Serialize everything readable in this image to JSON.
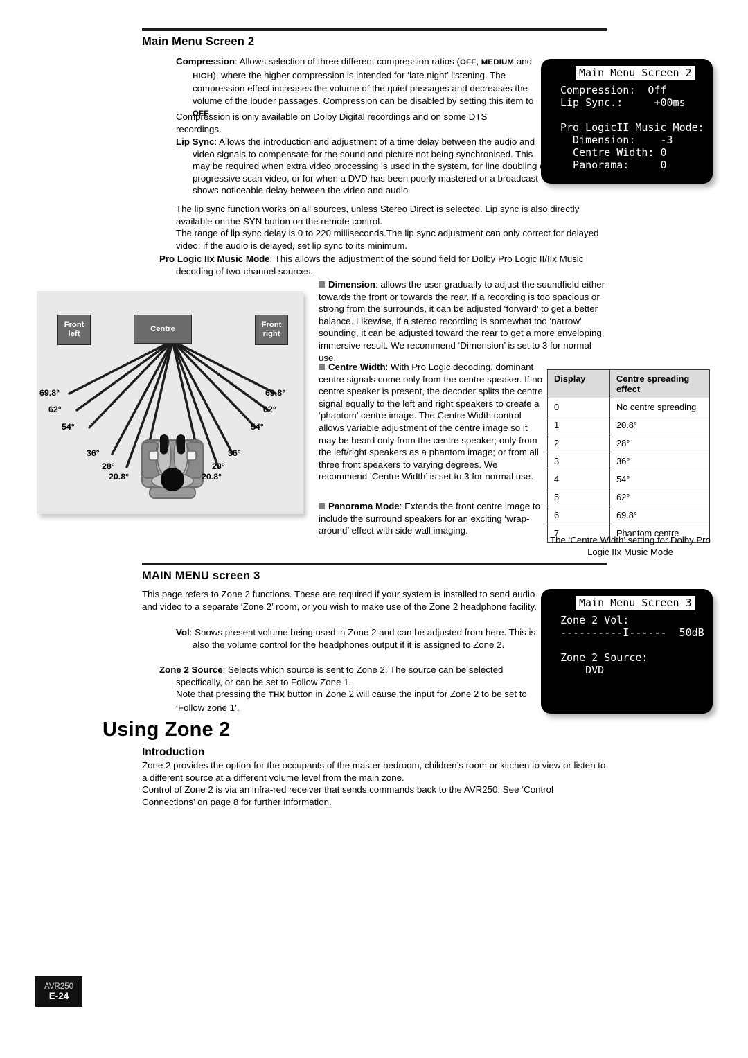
{
  "document": {
    "footer": {
      "model": "AVR250",
      "page": "E-24"
    }
  },
  "section1": {
    "heading": "Main Menu Screen 2",
    "compression": {
      "term": "Compression",
      "body_1": ": Allows selection of three different compression ratios (",
      "opt1": "OFF",
      "sep1": ", ",
      "opt2": "MEDIUM",
      "body_2": " and ",
      "opt3": "HIGH",
      "body_3": "), where the higher compression is intended for ‘late night’ listening. The compression effect increases the volume of the quiet passages and decreases the volume of the louder passages. Compression can be disabled by setting this item to ",
      "opt4": "OFF",
      "body_4": ".",
      "body_5": "Compression is only available on Dolby Digital recordings and on some DTS recordings."
    },
    "lipsync": {
      "term": "Lip Sync",
      "body_1": ": Allows the introduction and adjustment of a time delay between the audio and video signals to compensate for the sound and picture not being synchronised. This may be required when extra video processing is used in the system, for line doubling or progressive scan video, or for when a DVD has been poorly mastered or a broadcast shows noticeable delay between the video and audio.",
      "body_2": "The lip sync function works on all sources, unless Stereo Direct is selected. Lip sync is also directly available on the SYN button on the remote control.",
      "body_3": "The range of lip sync delay is 0 to 220 milliseconds.The lip sync adjustment can only correct for delayed video: if the audio is delayed, set lip sync to its minimum."
    },
    "plii": {
      "term": "Pro Logic IIx Music Mode",
      "body": ": This allows the adjustment of the sound field for Dolby Pro Logic II/IIx Music decoding of two-channel sources."
    }
  },
  "bullets": {
    "dimension": {
      "term": "Dimension",
      "body": ": allows the user gradually to adjust the soundfield either towards the front or towards the rear. If a recording is too spacious or strong from the surrounds, it can be adjusted ‘forward’ to get a better balance. Likewise, if a stereo recording is somewhat too ‘narrow’ sounding, it can be adjusted toward the rear to get a more enveloping, immersive result. We recommend ‘Dimension’ is set to 3 for normal use."
    },
    "centre_width": {
      "term": "Centre Width",
      "body": ": With Pro Logic decoding, dominant centre signals come only from the centre speaker. If no centre speaker is present, the decoder splits the centre signal equally to the left and right speakers to create a ‘phantom’ centre image. The Centre Width control allows variable adjustment of the centre image so it may be heard only from the centre speaker; only from the left/right speakers as a phantom image; or from all three front speakers to varying degrees. We recommend ‘Centre Width’ is set to 3 for normal use."
    },
    "panorama": {
      "term": "Panorama Mode",
      "body": ": Extends the front centre image to include the surround speakers for an exciting ‘wrap-around’ effect with side wall imaging."
    }
  },
  "osd2": {
    "title": "Main Menu Screen 2",
    "lines": [
      "Compression:  Off",
      "Lip Sync.:     +00ms",
      "",
      "Pro LogicII Music Mode:",
      "  Dimension:    -3",
      "  Centre Width: 0",
      "  Panorama:     0"
    ]
  },
  "osd3": {
    "title": "Main Menu Screen 3",
    "lines": [
      "Zone 2 Vol:",
      "----------I------  50dB",
      "",
      "Zone 2 Source:",
      "    DVD"
    ]
  },
  "table": {
    "headers": [
      "Display",
      "Centre spreading effect"
    ],
    "rows": [
      [
        "0",
        "No centre spreading"
      ],
      [
        "1",
        "20.8°"
      ],
      [
        "2",
        "28°"
      ],
      [
        "3",
        "36°"
      ],
      [
        "4",
        "54°"
      ],
      [
        "5",
        "62°"
      ],
      [
        "6",
        "69.8°"
      ],
      [
        "7",
        "Phantom centre"
      ]
    ],
    "caption": "The ‘Centre Width’ setting for Dolby Pro Logic IIx Music Mode"
  },
  "diagram": {
    "speakers": {
      "front_left": "Front left",
      "centre": "Centre",
      "front_right": "Front right"
    },
    "angles_left": [
      "69.8°",
      "62°",
      "54°",
      "36°",
      "28°",
      "20.8°"
    ],
    "angles_right": [
      "69.8°",
      "62°",
      "54°",
      "36°",
      "28°",
      "20.8°"
    ]
  },
  "section2": {
    "heading": "MAIN MENU screen 3",
    "intro": "This page refers to Zone 2 functions. These are required if your system is installed to send audio and video to a separate ‘Zone 2’ room, or you wish to make use of the Zone 2 headphone facility.",
    "vol": {
      "term": "Vol",
      "body": ": Shows present volume being used in Zone 2 and can be adjusted from here. This is also the volume control for the headphones output if it is assigned to Zone 2."
    },
    "zone2source": {
      "term": "Zone 2 Source",
      "body_1": ": Selects which source is sent to Zone 2. The source can be selected specifically, or can be set to Follow Zone 1.",
      "body_2a": "Note that pressing the ",
      "body_2b": "THX",
      "body_2c": " button in Zone 2 will cause the input for Zone 2 to be set to ‘Follow zone 1’."
    }
  },
  "section3": {
    "heading": "Using Zone 2",
    "subheading": "Introduction",
    "para_1": "Zone 2 provides the option for the occupants of the master bedroom, children’s room or kitchen to view or listen to a different source at a different volume level from the main zone.",
    "para_2": "Control of Zone 2 is via an infra-red receiver that sends commands back to the AVR250. See ‘Control Connections’ on page 8 for further information."
  }
}
